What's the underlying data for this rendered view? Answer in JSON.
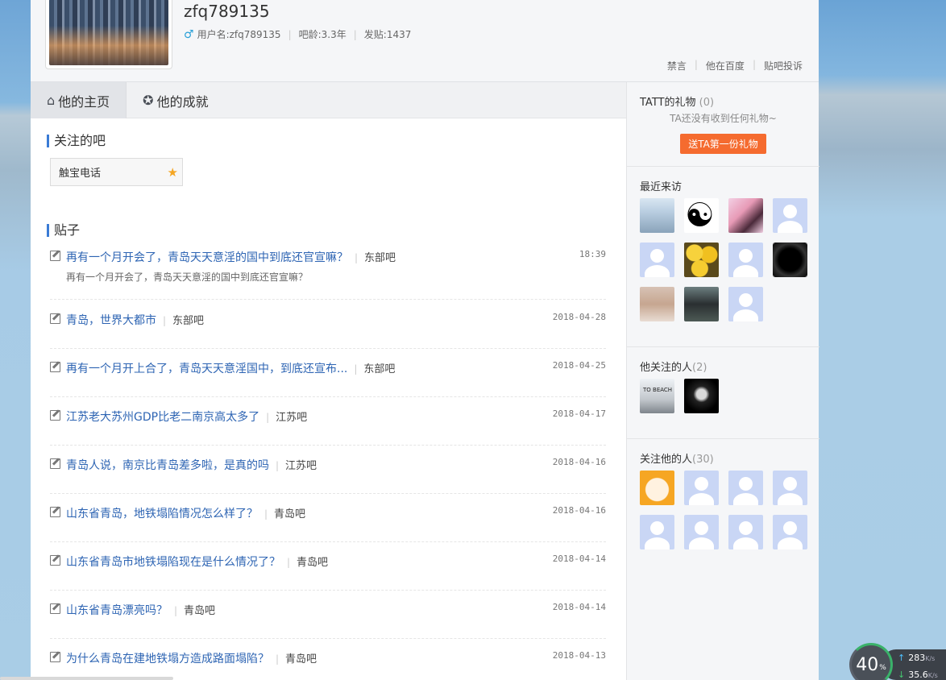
{
  "header": {
    "username": "zfq789135",
    "user_label": "用户名:zfq789135",
    "age": "吧龄:3.3年",
    "posts": "发贴:1437",
    "links": [
      "禁言",
      "他在百度",
      "贴吧投诉"
    ]
  },
  "tabs": [
    {
      "label": "他的主页",
      "active": true
    },
    {
      "label": "他的成就",
      "active": false
    }
  ],
  "followed_bars": {
    "title": "关注的吧",
    "items": [
      "触宝电话"
    ]
  },
  "posts_section": {
    "title": "贴子",
    "items": [
      {
        "title": "再有一个月开会了，青岛天天意淫的国中到底还官宣嘛？",
        "forum": "东部吧",
        "date": "18:39",
        "desc": "再有一个月开会了，青岛天天意淫的国中到底还官宣嘛？"
      },
      {
        "title": "青岛，世界大都市",
        "forum": "东部吧",
        "date": "2018-04-28"
      },
      {
        "title": "再有一个月开上合了，青岛天天意淫国中，到底还宣布...",
        "forum": "东部吧",
        "date": "2018-04-25"
      },
      {
        "title": "江苏老大苏州GDP比老二南京高太多了",
        "forum": "江苏吧",
        "date": "2018-04-17"
      },
      {
        "title": "青岛人说，南京比青岛差多啦，是真的吗",
        "forum": "江苏吧",
        "date": "2018-04-16"
      },
      {
        "title": "山东省青岛，地铁塌陷情况怎么样了？",
        "forum": "青岛吧",
        "date": "2018-04-16"
      },
      {
        "title": "山东省青岛市地铁塌陷现在是什么情况了？",
        "forum": "青岛吧",
        "date": "2018-04-14"
      },
      {
        "title": "山东省青岛漂亮吗？",
        "forum": "青岛吧",
        "date": "2018-04-14"
      },
      {
        "title": "为什么青岛在建地铁塌方造成路面塌陷？",
        "forum": "青岛吧",
        "date": "2018-04-13"
      }
    ]
  },
  "sidebar": {
    "gifts": {
      "title": "TATT的礼物",
      "count": "(0)",
      "empty": "TA还没有收到任何礼物~",
      "button": "送TA第一份礼物"
    },
    "visitors": {
      "title": "最近来访"
    },
    "following": {
      "title": "他关注的人",
      "count": "(2)"
    },
    "followers": {
      "title": "关注他的人",
      "count": "(30)"
    }
  },
  "speed_widget": {
    "percent": "40",
    "percent_unit": "%",
    "up": "283",
    "down": "35.6",
    "unit": "K/s"
  }
}
